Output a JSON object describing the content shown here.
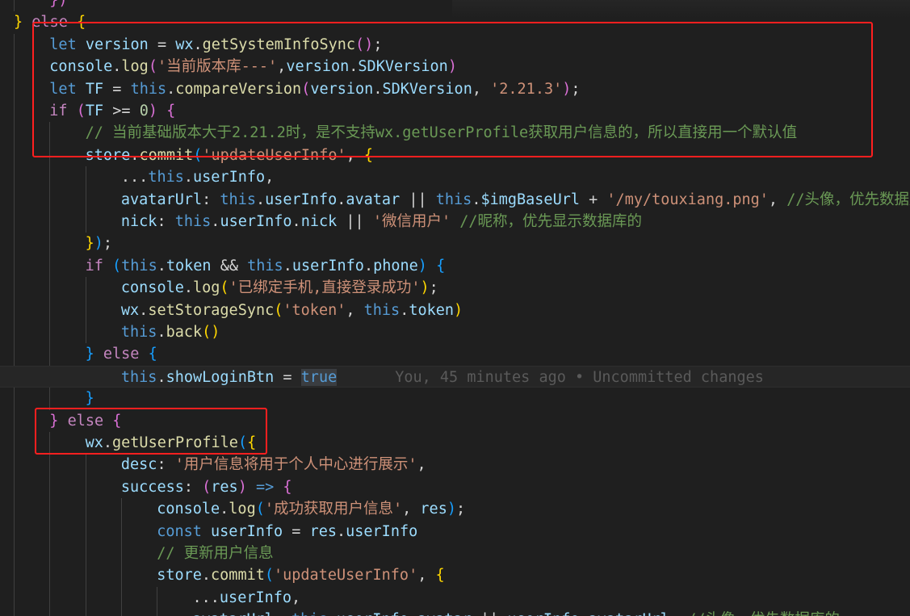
{
  "editor": {
    "theme_colors": {
      "background": "#1f1f1f",
      "keyword": "#569cd6",
      "control": "#c586c0",
      "variable": "#9cdcfe",
      "function": "#dcdcaa",
      "string": "#ce9178",
      "number": "#b5cea8",
      "comment": "#6a9955",
      "bracket_level1": "#ffd700",
      "bracket_level2": "#da70d6",
      "bracket_level3": "#179fff",
      "annotation_box": "#ff1f1f"
    },
    "lines": [
      {
        "indent": 1,
        "tokens": [
          [
            "b2",
            "})"
          ]
        ]
      },
      {
        "indent": 0,
        "tokens": [
          [
            "b1",
            "}"
          ],
          [
            "pun",
            " "
          ],
          [
            "ctrl",
            "else"
          ],
          [
            "pun",
            " "
          ],
          [
            "b1",
            "{"
          ]
        ]
      },
      {
        "indent": 1,
        "tokens": [
          [
            "kw",
            "let"
          ],
          [
            "pun",
            " "
          ],
          [
            "var",
            "version"
          ],
          [
            "pun",
            " = "
          ],
          [
            "var",
            "wx"
          ],
          [
            "pun",
            "."
          ],
          [
            "fn",
            "getSystemInfoSync"
          ],
          [
            "b2",
            "()"
          ],
          [
            "pun",
            ";"
          ]
        ]
      },
      {
        "indent": 1,
        "tokens": [
          [
            "var",
            "console"
          ],
          [
            "pun",
            "."
          ],
          [
            "fn",
            "log"
          ],
          [
            "b2",
            "("
          ],
          [
            "str",
            "'当前版本库---'"
          ],
          [
            "pun",
            ","
          ],
          [
            "var",
            "version"
          ],
          [
            "pun",
            "."
          ],
          [
            "var",
            "SDKVersion"
          ],
          [
            "b2",
            ")"
          ]
        ]
      },
      {
        "indent": 1,
        "tokens": [
          [
            "kw",
            "let"
          ],
          [
            "pun",
            " "
          ],
          [
            "var",
            "TF"
          ],
          [
            "pun",
            " = "
          ],
          [
            "kw",
            "this"
          ],
          [
            "pun",
            "."
          ],
          [
            "fn",
            "compareVersion"
          ],
          [
            "b2",
            "("
          ],
          [
            "var",
            "version"
          ],
          [
            "pun",
            "."
          ],
          [
            "var",
            "SDKVersion"
          ],
          [
            "pun",
            ", "
          ],
          [
            "str",
            "'2.21.3'"
          ],
          [
            "b2",
            ")"
          ],
          [
            "pun",
            ";"
          ]
        ]
      },
      {
        "indent": 1,
        "tokens": [
          [
            "ctrl",
            "if"
          ],
          [
            "pun",
            " "
          ],
          [
            "b2",
            "("
          ],
          [
            "var",
            "TF"
          ],
          [
            "pun",
            " >= "
          ],
          [
            "num",
            "0"
          ],
          [
            "b2",
            ")"
          ],
          [
            "pun",
            " "
          ],
          [
            "b2",
            "{"
          ]
        ]
      },
      {
        "indent": 2,
        "tokens": [
          [
            "cmt",
            "// 当前基础版本大于2.21.2时，是不支持wx.getUserProfile获取用户信息的，所以直接用一个默认值"
          ]
        ]
      },
      {
        "indent": 2,
        "tokens": [
          [
            "var",
            "store"
          ],
          [
            "pun",
            "."
          ],
          [
            "fn",
            "commit"
          ],
          [
            "b3",
            "("
          ],
          [
            "str",
            "'updateUserInfo'"
          ],
          [
            "pun",
            ", "
          ],
          [
            "b1",
            "{"
          ]
        ]
      },
      {
        "indent": 3,
        "tokens": [
          [
            "pun",
            "..."
          ],
          [
            "kw",
            "this"
          ],
          [
            "pun",
            "."
          ],
          [
            "var",
            "userInfo"
          ],
          [
            "pun",
            ","
          ]
        ]
      },
      {
        "indent": 3,
        "tokens": [
          [
            "var",
            "avatarUrl"
          ],
          [
            "pun",
            ": "
          ],
          [
            "kw",
            "this"
          ],
          [
            "pun",
            "."
          ],
          [
            "var",
            "userInfo"
          ],
          [
            "pun",
            "."
          ],
          [
            "var",
            "avatar"
          ],
          [
            "pun",
            " || "
          ],
          [
            "kw",
            "this"
          ],
          [
            "pun",
            "."
          ],
          [
            "var",
            "$imgBaseUrl"
          ],
          [
            "pun",
            " + "
          ],
          [
            "str",
            "'/my/touxiang.png'"
          ],
          [
            "pun",
            ", "
          ],
          [
            "cmt",
            "//头像，优先数据库的"
          ]
        ]
      },
      {
        "indent": 3,
        "tokens": [
          [
            "var",
            "nick"
          ],
          [
            "pun",
            ": "
          ],
          [
            "kw",
            "this"
          ],
          [
            "pun",
            "."
          ],
          [
            "var",
            "userInfo"
          ],
          [
            "pun",
            "."
          ],
          [
            "var",
            "nick"
          ],
          [
            "pun",
            " || "
          ],
          [
            "str",
            "'微信用户'"
          ],
          [
            "pun",
            " "
          ],
          [
            "cmt",
            "//昵称，优先显示数据库的"
          ]
        ]
      },
      {
        "indent": 2,
        "tokens": [
          [
            "b1",
            "}"
          ],
          [
            "b3",
            ")"
          ],
          [
            "pun",
            ";"
          ]
        ]
      },
      {
        "indent": 2,
        "tokens": [
          [
            "ctrl",
            "if"
          ],
          [
            "pun",
            " "
          ],
          [
            "b3",
            "("
          ],
          [
            "kw",
            "this"
          ],
          [
            "pun",
            "."
          ],
          [
            "var",
            "token"
          ],
          [
            "pun",
            " && "
          ],
          [
            "kw",
            "this"
          ],
          [
            "pun",
            "."
          ],
          [
            "var",
            "userInfo"
          ],
          [
            "pun",
            "."
          ],
          [
            "var",
            "phone"
          ],
          [
            "b3",
            ")"
          ],
          [
            "pun",
            " "
          ],
          [
            "b3",
            "{"
          ]
        ]
      },
      {
        "indent": 3,
        "tokens": [
          [
            "var",
            "console"
          ],
          [
            "pun",
            "."
          ],
          [
            "fn",
            "log"
          ],
          [
            "b1",
            "("
          ],
          [
            "str",
            "'已绑定手机,直接登录成功'"
          ],
          [
            "b1",
            ")"
          ],
          [
            "pun",
            ";"
          ]
        ]
      },
      {
        "indent": 3,
        "tokens": [
          [
            "var",
            "wx"
          ],
          [
            "pun",
            "."
          ],
          [
            "fn",
            "setStorageSync"
          ],
          [
            "b1",
            "("
          ],
          [
            "str",
            "'token'"
          ],
          [
            "pun",
            ", "
          ],
          [
            "kw",
            "this"
          ],
          [
            "pun",
            "."
          ],
          [
            "var",
            "token"
          ],
          [
            "b1",
            ")"
          ]
        ]
      },
      {
        "indent": 3,
        "tokens": [
          [
            "kw",
            "this"
          ],
          [
            "pun",
            "."
          ],
          [
            "fn",
            "back"
          ],
          [
            "b1",
            "()"
          ]
        ]
      },
      {
        "indent": 2,
        "tokens": [
          [
            "b3",
            "}"
          ],
          [
            "pun",
            " "
          ],
          [
            "ctrl",
            "else"
          ],
          [
            "pun",
            " "
          ],
          [
            "b3",
            "{"
          ]
        ]
      },
      {
        "indent": 3,
        "current": true,
        "tokens": [
          [
            "kw",
            "this"
          ],
          [
            "pun",
            "."
          ],
          [
            "var",
            "showLoginBtn"
          ],
          [
            "pun",
            " = "
          ],
          [
            "kwhl",
            "true"
          ]
        ],
        "blame": "You, 45 minutes ago • Uncommitted changes"
      },
      {
        "indent": 2,
        "tokens": [
          [
            "b3",
            "}"
          ]
        ]
      },
      {
        "indent": 1,
        "tokens": [
          [
            "b2",
            "}"
          ],
          [
            "pun",
            " "
          ],
          [
            "ctrl",
            "else"
          ],
          [
            "pun",
            " "
          ],
          [
            "b2",
            "{"
          ]
        ]
      },
      {
        "indent": 2,
        "tokens": [
          [
            "var",
            "wx"
          ],
          [
            "pun",
            "."
          ],
          [
            "fn",
            "getUserProfile"
          ],
          [
            "b3",
            "("
          ],
          [
            "b1",
            "{"
          ]
        ]
      },
      {
        "indent": 3,
        "tokens": [
          [
            "var",
            "desc"
          ],
          [
            "pun",
            ": "
          ],
          [
            "str",
            "'用户信息将用于个人中心进行展示'"
          ],
          [
            "pun",
            ","
          ]
        ]
      },
      {
        "indent": 3,
        "tokens": [
          [
            "var",
            "success"
          ],
          [
            "pun",
            ": "
          ],
          [
            "b2",
            "("
          ],
          [
            "var",
            "res"
          ],
          [
            "b2",
            ")"
          ],
          [
            "pun",
            " "
          ],
          [
            "kw",
            "=>"
          ],
          [
            "pun",
            " "
          ],
          [
            "b2",
            "{"
          ]
        ]
      },
      {
        "indent": 4,
        "tokens": [
          [
            "var",
            "console"
          ],
          [
            "pun",
            "."
          ],
          [
            "fn",
            "log"
          ],
          [
            "b3",
            "("
          ],
          [
            "str",
            "'成功获取用户信息'"
          ],
          [
            "pun",
            ", "
          ],
          [
            "var",
            "res"
          ],
          [
            "b3",
            ")"
          ],
          [
            "pun",
            ";"
          ]
        ]
      },
      {
        "indent": 4,
        "tokens": [
          [
            "kw",
            "const"
          ],
          [
            "pun",
            " "
          ],
          [
            "var",
            "userInfo"
          ],
          [
            "pun",
            " = "
          ],
          [
            "var",
            "res"
          ],
          [
            "pun",
            "."
          ],
          [
            "var",
            "userInfo"
          ]
        ]
      },
      {
        "indent": 4,
        "tokens": [
          [
            "cmt",
            "// 更新用户信息"
          ]
        ]
      },
      {
        "indent": 4,
        "tokens": [
          [
            "var",
            "store"
          ],
          [
            "pun",
            "."
          ],
          [
            "fn",
            "commit"
          ],
          [
            "b3",
            "("
          ],
          [
            "str",
            "'updateUserInfo'"
          ],
          [
            "pun",
            ", "
          ],
          [
            "b1",
            "{"
          ]
        ]
      },
      {
        "indent": 5,
        "tokens": [
          [
            "pun",
            "..."
          ],
          [
            "var",
            "userInfo"
          ],
          [
            "pun",
            ","
          ]
        ]
      },
      {
        "indent": 5,
        "tokens": [
          [
            "var",
            "avatarUrl"
          ],
          [
            "pun",
            ": "
          ],
          [
            "kw",
            "this"
          ],
          [
            "pun",
            "."
          ],
          [
            "var",
            "userInfo"
          ],
          [
            "pun",
            "."
          ],
          [
            "var",
            "avatar"
          ],
          [
            "pun",
            " || "
          ],
          [
            "var",
            "userInfo"
          ],
          [
            "pun",
            "."
          ],
          [
            "var",
            "avatarUrl"
          ],
          [
            "pun",
            ", "
          ],
          [
            "cmt",
            "//头像，优先数据库的"
          ]
        ]
      }
    ]
  }
}
